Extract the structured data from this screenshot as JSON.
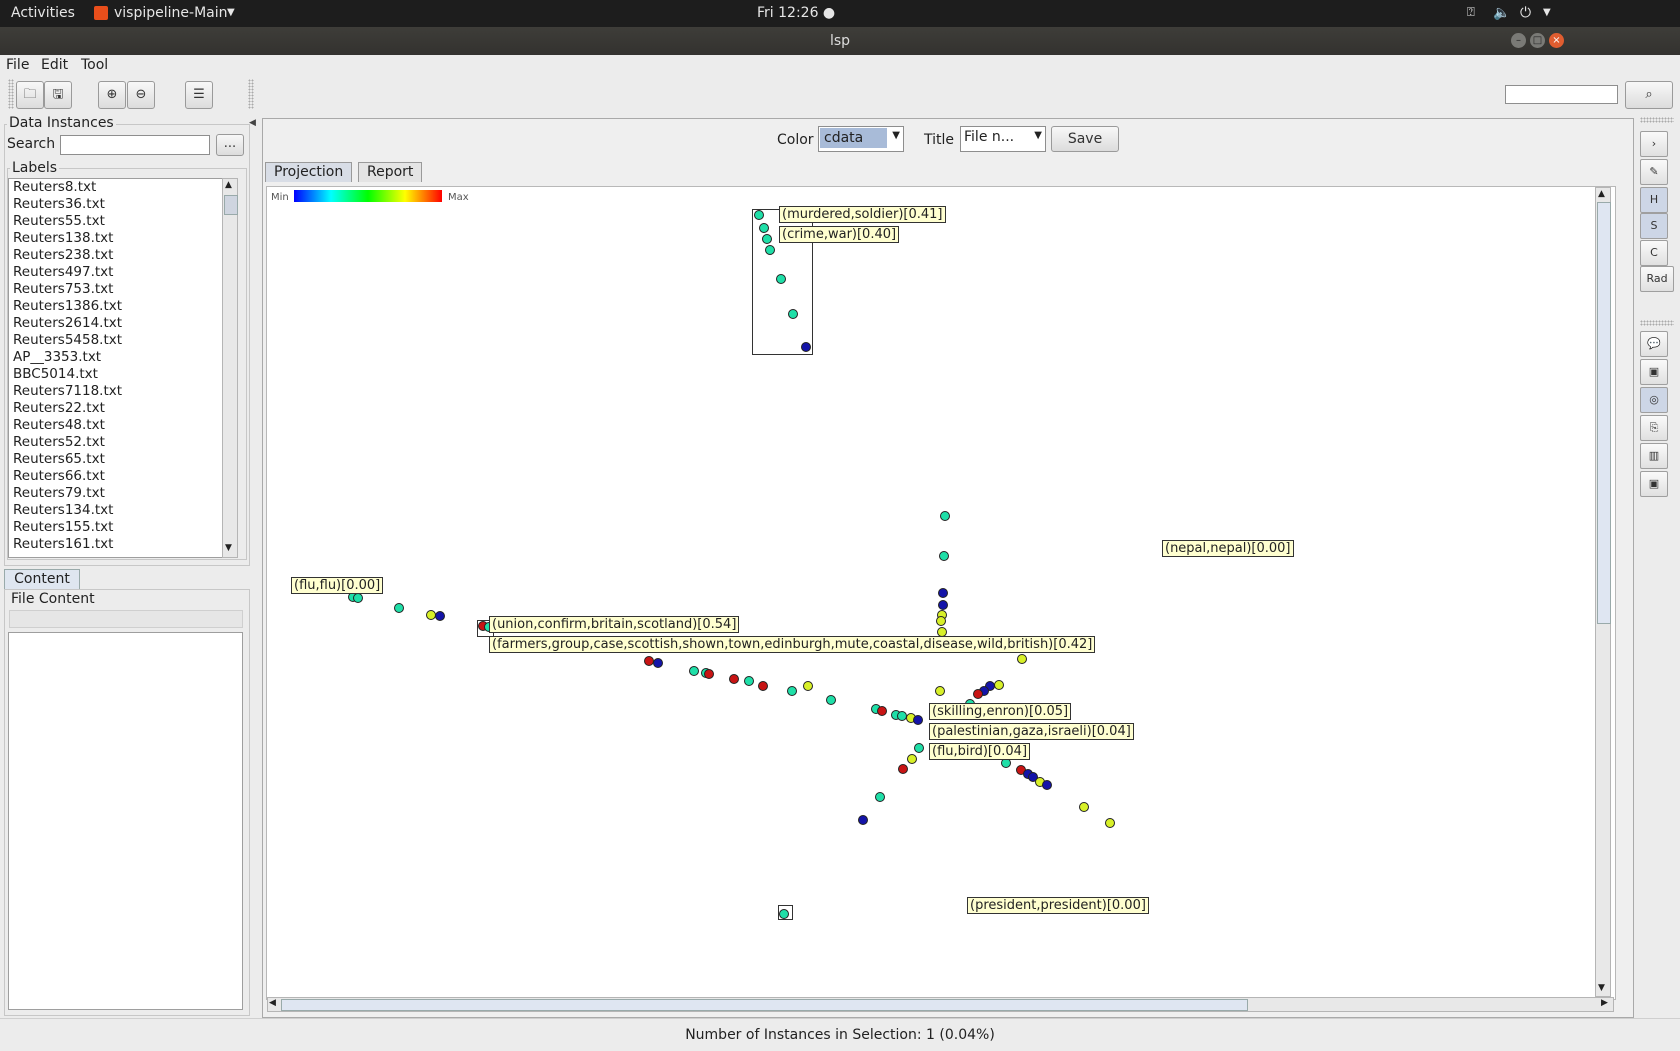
{
  "system_bar": {
    "activities": "Activities",
    "app_name": "vispipeline-Main",
    "clock": "Fri 12:26 ●"
  },
  "window": {
    "title": "lsp"
  },
  "menu": {
    "file": "File",
    "edit": "Edit",
    "tool": "Tool"
  },
  "sidebar": {
    "data_instances_title": "Data Instances",
    "search_label": "Search",
    "search_value": "",
    "more_button": "...",
    "labels_title": "Labels",
    "labels": [
      "Reuters8.txt",
      "Reuters36.txt",
      "Reuters55.txt",
      "Reuters138.txt",
      "Reuters238.txt",
      "Reuters497.txt",
      "Reuters753.txt",
      "Reuters1386.txt",
      "Reuters2614.txt",
      "Reuters5458.txt",
      "AP__3353.txt",
      "BBC5014.txt",
      "Reuters7118.txt",
      "Reuters22.txt",
      "Reuters48.txt",
      "Reuters52.txt",
      "Reuters65.txt",
      "Reuters66.txt",
      "Reuters79.txt",
      "Reuters134.txt",
      "Reuters155.txt",
      "Reuters161.txt"
    ],
    "content_tab": "Content",
    "file_content_title": "File Content"
  },
  "main": {
    "color_label": "Color",
    "color_value": "cdata",
    "title_label": "Title",
    "title_value": "File n...",
    "save_button": "Save",
    "tabs": [
      "Projection",
      "Report"
    ],
    "colorscale": {
      "min": "Min",
      "max": "Max"
    },
    "topic_labels": [
      "(murdered,soldier)[0.41]",
      "(crime,war)[0.40]",
      "(nepal,nepal)[0.00]",
      "(flu,flu)[0.00]",
      "(union,confirm,britain,scotland)[0.54]",
      "(farmers,group,case,scottish,shown,town,edinburgh,mute,coastal,disease,wild,british)[0.42]",
      "(skilling,enron)[0.05]",
      "(palestinian,gaza,israeli)[0.04]",
      "(flu,bird)[0.04]",
      "(president,president)[0.00]"
    ]
  },
  "right_tools": {
    "h": "H",
    "s": "S",
    "c": "C",
    "rad": "Rad"
  },
  "status": {
    "selection_text": "Number of Instances in Selection: 1 (0.04%)"
  },
  "colors": {
    "teal": "#1fdfa8",
    "navy": "#1414a8",
    "red": "#c81414",
    "yellow": "#d8f028",
    "label_bg": "#ffffd0"
  },
  "points": [
    {
      "c": "teal",
      "v": [
        708,
        201
      ]
    },
    {
      "c": "teal",
      "v": [
        713,
        213
      ]
    },
    {
      "c": "teal",
      "v": [
        716,
        223
      ]
    },
    {
      "c": "teal",
      "v": [
        719,
        233
      ]
    },
    {
      "c": "teal",
      "v": [
        729,
        260
      ]
    },
    {
      "c": "teal",
      "v": [
        740,
        293
      ]
    },
    {
      "c": "navy",
      "v": [
        752,
        324
      ]
    },
    {
      "c": "teal",
      "v": [
        882,
        482
      ]
    },
    {
      "c": "teal",
      "v": [
        881,
        519
      ]
    },
    {
      "c": "navy",
      "v": [
        880,
        553
      ]
    },
    {
      "c": "navy",
      "v": [
        880,
        565
      ]
    },
    {
      "c": "yellow",
      "v": [
        879,
        574
      ]
    },
    {
      "c": "yellow",
      "v": [
        878,
        580
      ]
    },
    {
      "c": "yellow",
      "v": [
        879,
        590
      ]
    },
    {
      "c": "teal",
      "v": [
        329,
        557
      ]
    },
    {
      "c": "teal",
      "v": [
        334,
        558
      ]
    },
    {
      "c": "teal",
      "v": [
        372,
        567
      ]
    },
    {
      "c": "yellow",
      "v": [
        402,
        574
      ]
    },
    {
      "c": "navy",
      "v": [
        411,
        575
      ]
    },
    {
      "c": "red",
      "v": [
        451,
        584
      ]
    },
    {
      "c": "teal",
      "v": [
        456,
        585
      ]
    },
    {
      "c": "red",
      "v": [
        606,
        617
      ]
    },
    {
      "c": "navy",
      "v": [
        614,
        619
      ]
    },
    {
      "c": "teal",
      "v": [
        648,
        626
      ]
    },
    {
      "c": "teal",
      "v": [
        659,
        628
      ]
    },
    {
      "c": "red",
      "v": [
        662,
        629
      ]
    },
    {
      "c": "red",
      "v": [
        685,
        634
      ]
    },
    {
      "c": "teal",
      "v": [
        699,
        636
      ]
    },
    {
      "c": "red",
      "v": [
        712,
        640
      ]
    },
    {
      "c": "teal",
      "v": [
        739,
        645
      ]
    },
    {
      "c": "yellow",
      "v": [
        754,
        640
      ]
    },
    {
      "c": "teal",
      "v": [
        776,
        653
      ]
    },
    {
      "c": "teal",
      "v": [
        818,
        662
      ]
    },
    {
      "c": "red",
      "v": [
        823,
        664
      ]
    },
    {
      "c": "teal",
      "v": [
        836,
        667
      ]
    },
    {
      "c": "teal",
      "v": [
        842,
        668
      ]
    },
    {
      "c": "yellow",
      "v": [
        850,
        670
      ]
    },
    {
      "c": "navy",
      "v": [
        857,
        672
      ]
    },
    {
      "c": "yellow",
      "v": [
        954,
        615
      ]
    },
    {
      "c": "yellow",
      "v": [
        877,
        645
      ]
    },
    {
      "c": "yellow",
      "v": [
        932,
        639
      ]
    },
    {
      "c": "navy",
      "v": [
        924,
        640
      ]
    },
    {
      "c": "navy",
      "v": [
        918,
        645
      ]
    },
    {
      "c": "red",
      "v": [
        913,
        648
      ]
    },
    {
      "c": "teal",
      "v": [
        905,
        657
      ]
    },
    {
      "c": "teal",
      "v": [
        858,
        698
      ]
    },
    {
      "c": "yellow",
      "v": [
        851,
        708
      ]
    },
    {
      "c": "red",
      "v": [
        843,
        718
      ]
    },
    {
      "c": "teal",
      "v": [
        821,
        744
      ]
    },
    {
      "c": "navy",
      "v": [
        805,
        765
      ]
    },
    {
      "c": "teal",
      "v": [
        939,
        712
      ]
    },
    {
      "c": "red",
      "v": [
        953,
        719
      ]
    },
    {
      "c": "navy",
      "v": [
        959,
        722
      ]
    },
    {
      "c": "navy",
      "v": [
        964,
        725
      ]
    },
    {
      "c": "yellow",
      "v": [
        971,
        730
      ]
    },
    {
      "c": "navy",
      "v": [
        977,
        733
      ]
    },
    {
      "c": "yellow",
      "v": [
        1012,
        753
      ]
    },
    {
      "c": "yellow",
      "v": [
        1036,
        768
      ]
    },
    {
      "c": "teal",
      "v": [
        732,
        853
      ]
    }
  ]
}
